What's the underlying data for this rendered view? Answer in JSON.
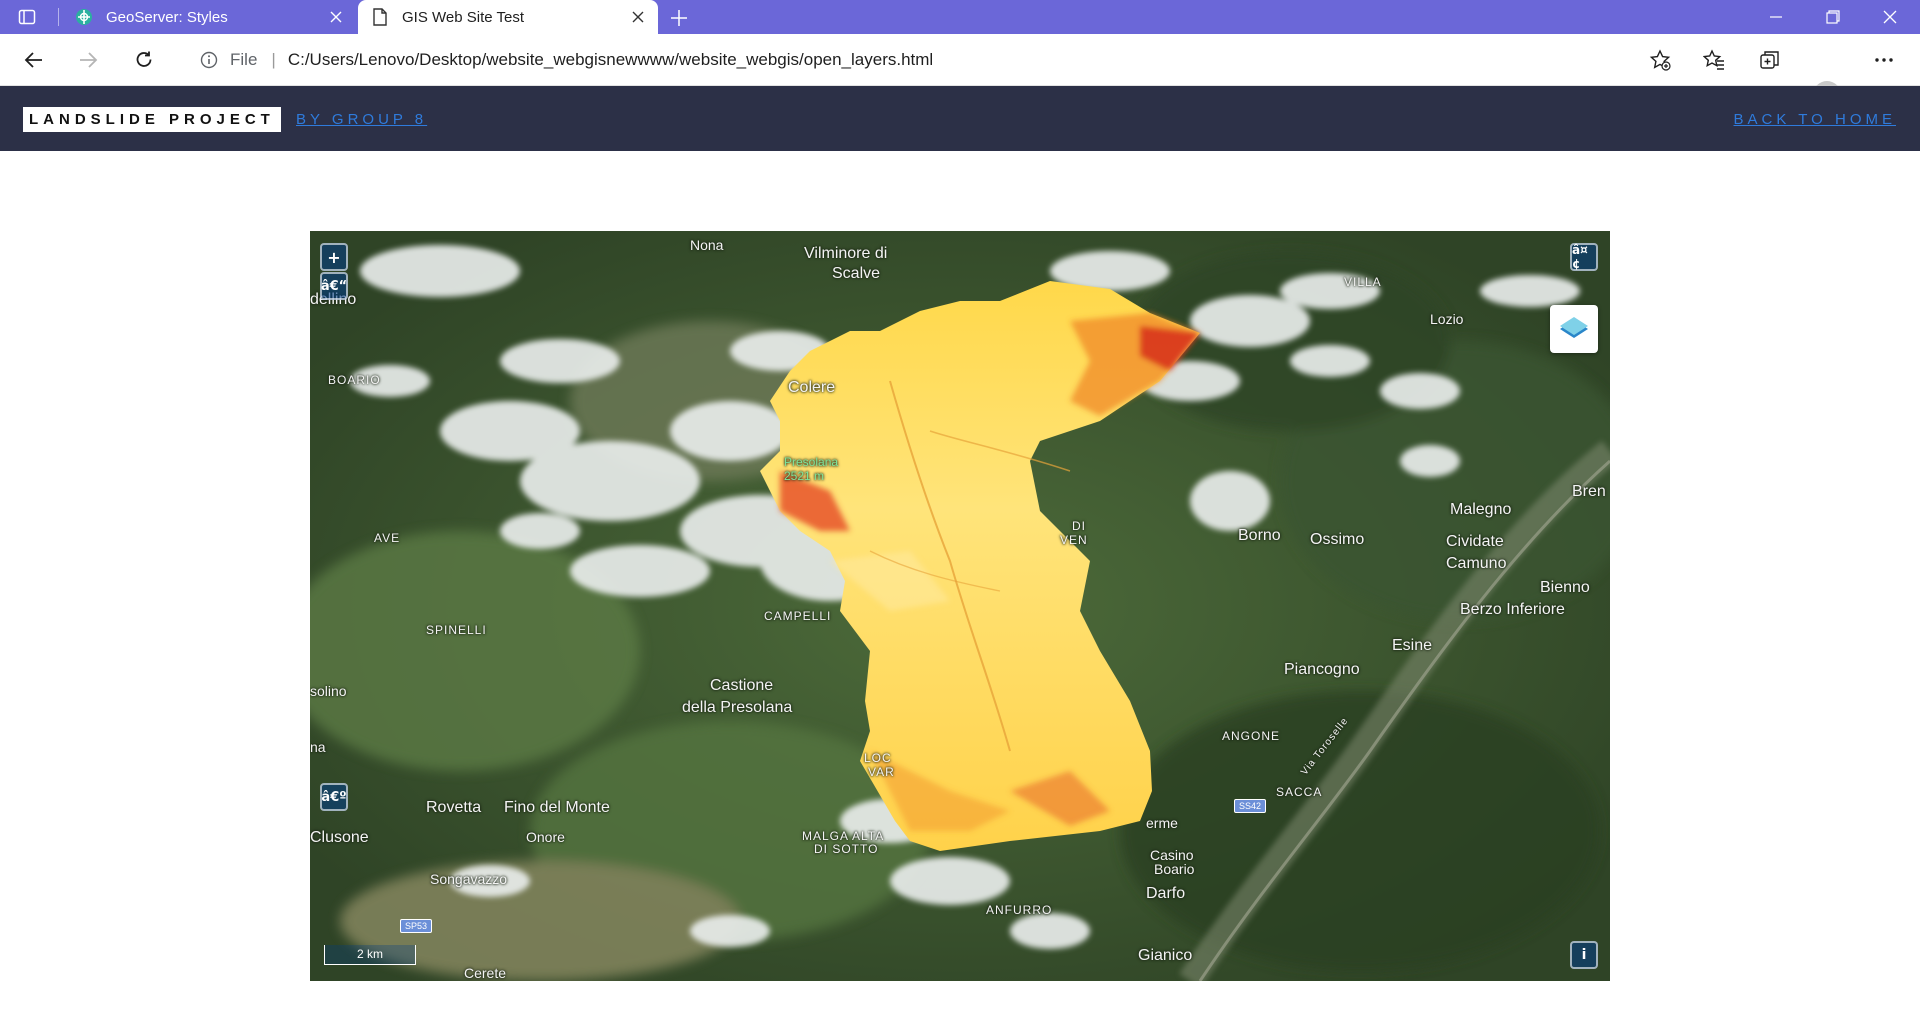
{
  "browser": {
    "tabs": [
      {
        "title": "GeoServer: Styles",
        "icon": "geoserver-icon",
        "active": false
      },
      {
        "title": "GIS Web Site Test",
        "icon": "page-icon",
        "active": true
      }
    ],
    "address": {
      "scheme": "File",
      "url": "C:/Users/Lenovo/Desktop/website_webgisnewwww/website_webgis/open_layers.html"
    },
    "accent": "#6b67d8"
  },
  "header": {
    "brand": "LANDSLIDE PROJECT",
    "subtitle": "BY GROUP 8",
    "back_link": "BACK TO HOME",
    "background": "#2c3047"
  },
  "map": {
    "controls": {
      "zoom_in": "+",
      "zoom_out": "â€“",
      "fullscreen": "â¤¢",
      "rotate": "â€º",
      "attribution": "i"
    },
    "scale_label": "2 km",
    "road_shields": [
      "SP53",
      "SS42"
    ],
    "place_names": [
      {
        "text": "Nona"
      },
      {
        "text": "Vilminore di"
      },
      {
        "text": "Scalve"
      },
      {
        "text": "VILLA"
      },
      {
        "text": "Lozio"
      },
      {
        "text": "dellino"
      },
      {
        "text": "BOARIO"
      },
      {
        "text": "Colere"
      },
      {
        "text": "Presolana"
      },
      {
        "text": "2521 m"
      },
      {
        "text": "Malegno"
      },
      {
        "text": "Bren"
      },
      {
        "text": "AVE"
      },
      {
        "text": "DI"
      },
      {
        "text": "VEN"
      },
      {
        "text": "Borno"
      },
      {
        "text": "Ossimo"
      },
      {
        "text": "Cividate"
      },
      {
        "text": "Camuno"
      },
      {
        "text": "Bienno"
      },
      {
        "text": "Berzo Inferiore"
      },
      {
        "text": "SPINELLI"
      },
      {
        "text": "CAMPELLI"
      },
      {
        "text": "Esine"
      },
      {
        "text": "Piancogno"
      },
      {
        "text": "Castione"
      },
      {
        "text": "della Presolana"
      },
      {
        "text": "solino"
      },
      {
        "text": "ANGONE"
      },
      {
        "text": "Via Toroselle"
      },
      {
        "text": "na"
      },
      {
        "text": "LOC"
      },
      {
        "text": "VAR"
      },
      {
        "text": "SACCA"
      },
      {
        "text": "Rovetta"
      },
      {
        "text": "Fino del Monte"
      },
      {
        "text": "Clusone"
      },
      {
        "text": "Onore"
      },
      {
        "text": "MALGA ALTA"
      },
      {
        "text": "DI SOTTO"
      },
      {
        "text": "erme"
      },
      {
        "text": "Casino"
      },
      {
        "text": "Boario"
      },
      {
        "text": "Songavazzo"
      },
      {
        "text": "ANFURRO"
      },
      {
        "text": "Darfo"
      },
      {
        "text": "Gianico"
      },
      {
        "text": "Cerete"
      }
    ]
  }
}
